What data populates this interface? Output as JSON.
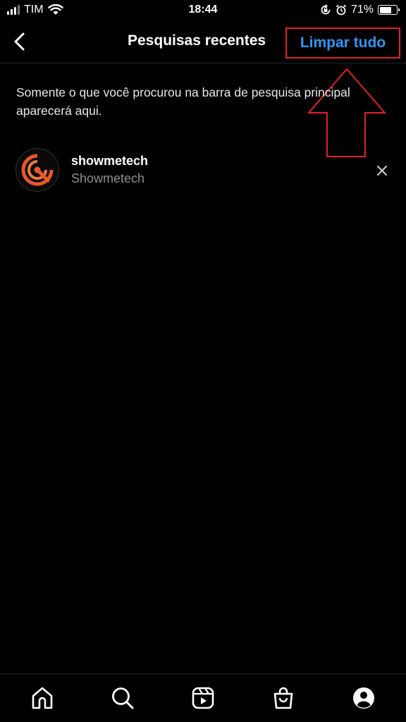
{
  "status_bar": {
    "carrier": "TIM",
    "time": "18:44",
    "battery": "71%",
    "battery_level": 0.71,
    "icons": [
      "signal-icon",
      "wifi-icon",
      "rotation-lock-icon",
      "alarm-icon",
      "battery-icon"
    ]
  },
  "header": {
    "back_icon": "chevron-left-icon",
    "title": "Pesquisas recentes",
    "clear_all": "Limpar tudo"
  },
  "info_text": "Somente o que você procurou na barra de pesquisa principal aparecerá aqui.",
  "recent_searches": [
    {
      "username": "showmetech",
      "full_name": "Showmetech",
      "avatar_icon": "showmetech-logo",
      "remove_icon": "close-icon"
    }
  ],
  "bottom_nav": [
    "home-icon",
    "search-icon",
    "reels-icon",
    "shop-icon",
    "profile-icon"
  ],
  "colors": {
    "background": "#000000",
    "accent_blue": "#2f96f3",
    "annotation_red": "#e0202a",
    "secondary_text": "#8e8e8e",
    "logo_orange": "#e8572a"
  }
}
